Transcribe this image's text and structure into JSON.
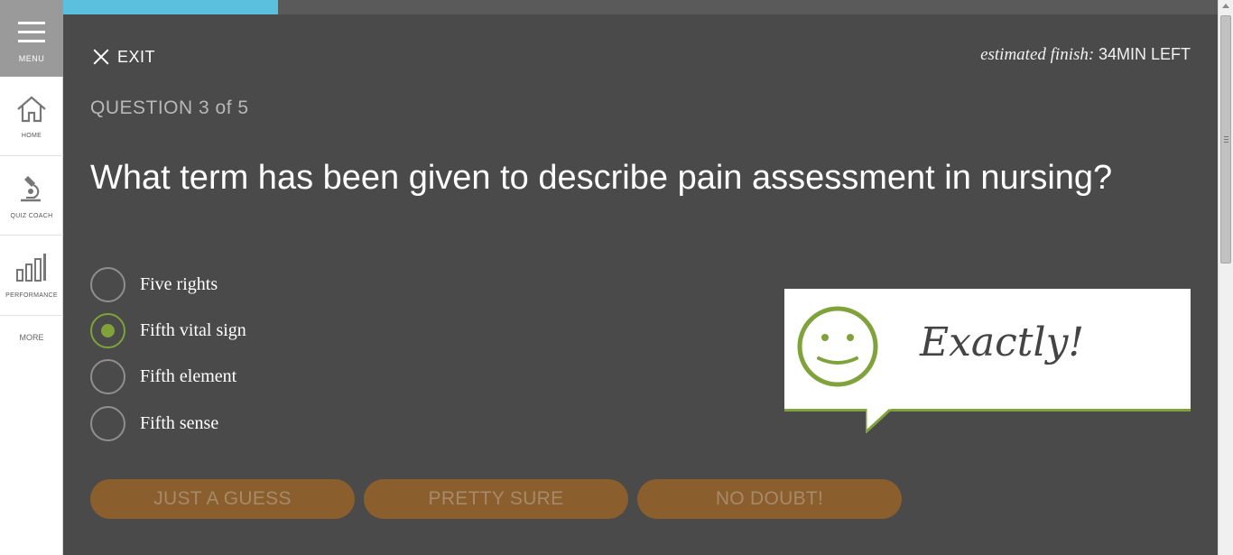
{
  "sidebar": {
    "menu_label": "MENU",
    "items": [
      {
        "label": "HOME",
        "icon": "home-icon"
      },
      {
        "label": "QUIZ COACH",
        "icon": "microscope-icon"
      },
      {
        "label": "PERFORMANCE",
        "icon": "bar-chart-icon"
      }
    ],
    "more_label": "MORE"
  },
  "progress": {
    "fraction": 0.186,
    "color": "#5bc0de"
  },
  "header": {
    "exit_label": "EXIT",
    "finish_prefix": "estimated finish: ",
    "finish_value": "34MIN LEFT"
  },
  "question": {
    "counter": "QUESTION 3 of 5",
    "text": "What term has been given to describe pain assessment in nursing?",
    "options": [
      {
        "label": "Five rights",
        "selected": false
      },
      {
        "label": "Fifth vital sign",
        "selected": true
      },
      {
        "label": "Fifth element",
        "selected": false
      },
      {
        "label": "Fifth sense",
        "selected": false
      }
    ]
  },
  "feedback": {
    "text": "Exactly!",
    "icon": "smiley-icon",
    "accent": "#7fa33a"
  },
  "confidence": {
    "buttons": [
      "JUST A GUESS",
      "PRETTY SURE",
      "NO DOUBT!"
    ]
  },
  "colors": {
    "background": "#4a4a4a",
    "button": "#8a5e2d",
    "accent": "#7fa33a"
  }
}
